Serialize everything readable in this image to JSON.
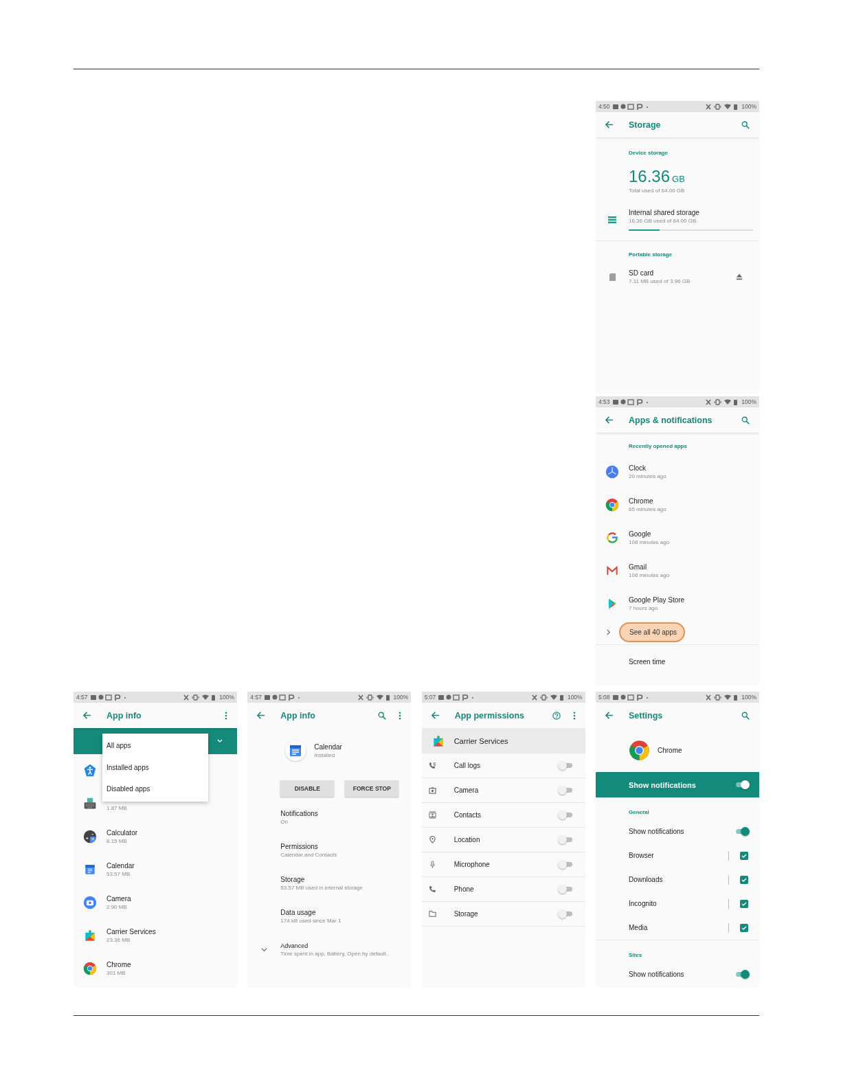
{
  "storage_screen": {
    "status_bar": {
      "time": "4:50",
      "battery": "100%"
    },
    "title": "Storage",
    "device_header": "Device storage",
    "used_amount": "16.36",
    "used_unit": "GB",
    "used_caption": "Total used of 64.00 GB",
    "internal_storage": {
      "name": "Internal shared storage",
      "detail": "16.36 GB used of 64.00 GB",
      "level": 0.25
    },
    "portable_header": "Portable storage",
    "sd_card": {
      "name": "SD card",
      "detail": "7.11 MB used of 3.96 GB"
    }
  },
  "apps_screen": {
    "status_bar": {
      "time": "4:53",
      "battery": "100%"
    },
    "title": "Apps & notifications",
    "recent_header": "Recently opened apps",
    "recent_apps": [
      {
        "name": "Clock",
        "detail": "20 minutes ago"
      },
      {
        "name": "Chrome",
        "detail": "65 minutes ago"
      },
      {
        "name": "Google",
        "detail": "108 minutes ago"
      },
      {
        "name": "Gmail",
        "detail": "108 minutes ago"
      },
      {
        "name": "Google Play Store",
        "detail": "7 hours ago"
      }
    ],
    "see_all": {
      "label": "See all 40 apps",
      "highlighted": true
    },
    "items": [
      "Screen time"
    ]
  },
  "app_list_screen": {
    "status_bar": {
      "time": "4:57",
      "battery": "100%"
    },
    "title": "App info",
    "filter_menu": [
      {
        "label": "All apps"
      },
      {
        "label": "Installed apps"
      },
      {
        "label": "Disabled apps"
      }
    ],
    "apps": [
      {
        "size": "1.87 MB"
      },
      {
        "name": "Calculator",
        "size": "8.15 MB"
      },
      {
        "name": "Calendar",
        "size": "53.57 MB"
      },
      {
        "name": "Camera",
        "size": "2.90 MB"
      },
      {
        "name": "Carrier Services",
        "size": "23.36 MB"
      },
      {
        "name": "Chrome",
        "size": "301 MB"
      }
    ]
  },
  "app_info_screen": {
    "status_bar": {
      "time": "4:57",
      "battery": "100%"
    },
    "title": "App info",
    "app": {
      "name": "Calendar",
      "status": "Installed"
    },
    "buttons": [
      "DISABLE",
      "FORCE STOP"
    ],
    "items": [
      {
        "title": "Notifications",
        "detail": "On"
      },
      {
        "title": "Permissions",
        "detail": "Calendar and Contacts"
      },
      {
        "title": "Storage",
        "detail": "53.57 MB used in internal storage"
      },
      {
        "title": "Data usage",
        "detail": "174 kB used since Mar 1"
      }
    ],
    "advanced": {
      "title": "Advanced",
      "detail": "Time spent in app, Battery, Open by default..",
      "expanded": false
    }
  },
  "permissions_screen": {
    "status_bar": {
      "time": "5:07",
      "battery": "100%"
    },
    "title": "App permissions",
    "app_name": "Carrier Services",
    "permissions": [
      {
        "name": "Call logs",
        "on": false
      },
      {
        "name": "Camera",
        "on": false
      },
      {
        "name": "Contacts",
        "on": false
      },
      {
        "name": "Location",
        "on": false
      },
      {
        "name": "Microphone",
        "on": false
      },
      {
        "name": "Phone",
        "on": false
      },
      {
        "name": "Storage",
        "on": false
      }
    ]
  },
  "notification_settings_screen": {
    "status_bar": {
      "time": "5:08",
      "battery": "100%"
    },
    "title": "Settings",
    "app_name": "Chrome",
    "master": {
      "label": "Show notifications",
      "on": true
    },
    "general_header": "General",
    "general": [
      {
        "kind": "switch",
        "label": "Show notifications",
        "on": true
      },
      {
        "kind": "checkbox",
        "label": "Browser",
        "checked": true
      },
      {
        "kind": "checkbox",
        "label": "Downloads",
        "checked": true
      },
      {
        "kind": "checkbox",
        "label": "Incognito",
        "checked": true
      },
      {
        "kind": "checkbox",
        "label": "Media",
        "checked": true
      }
    ],
    "sites_header": "Sites",
    "sites": [
      {
        "kind": "switch",
        "label": "Show notifications",
        "on": true
      }
    ]
  }
}
